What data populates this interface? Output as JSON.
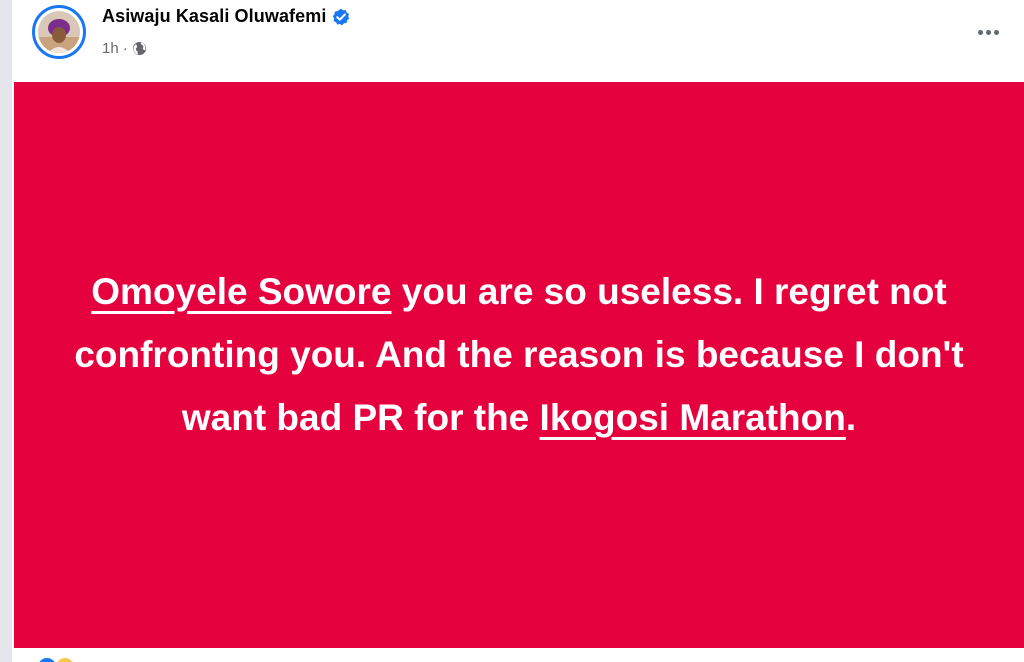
{
  "post": {
    "author": {
      "name": "Asiwaju Kasali Oluwafemi",
      "verified": true,
      "avatar_icon": "profile-photo"
    },
    "timestamp": "1h",
    "separator": "·",
    "audience_icon": "globe-icon",
    "more_icon": "more-options-icon",
    "background_color": "#e4013d",
    "text": {
      "segment_1": "Omoyele Sowore",
      "segment_2": " you are so useless. I regret not confronting you. And the reason is because I don't want bad PR for the ",
      "segment_3": "Ikogosi Marathon",
      "segment_4": "."
    }
  },
  "colors": {
    "verified_badge": "#1877f2",
    "meta_text": "#65676b",
    "post_text": "#ffffff"
  }
}
